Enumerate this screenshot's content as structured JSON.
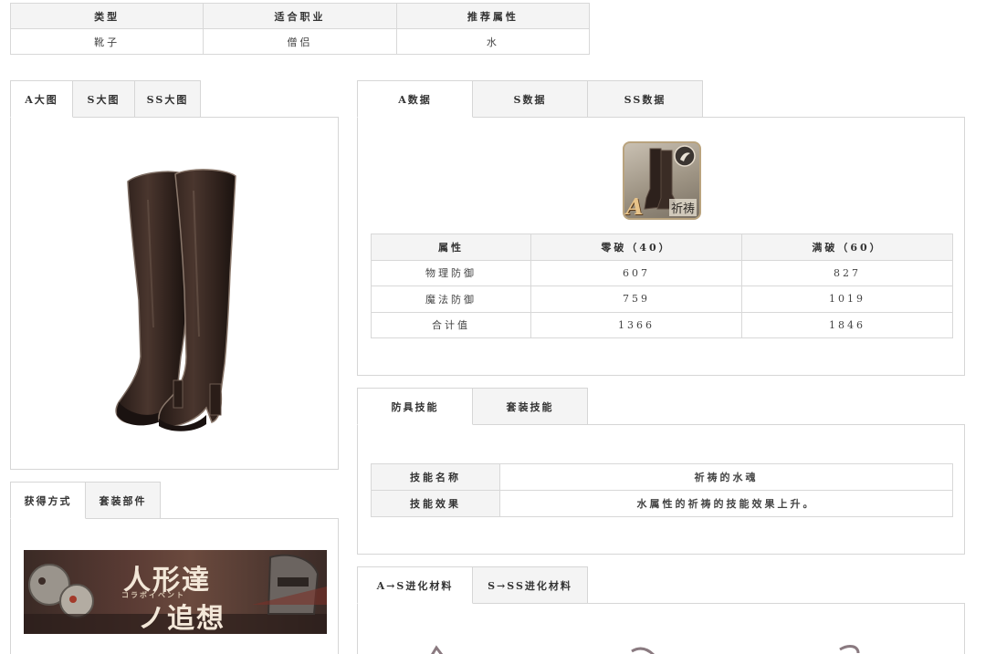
{
  "info": {
    "headers": [
      "类型",
      "适合职业",
      "推荐属性"
    ],
    "values": [
      "靴子",
      "僧侣",
      "水"
    ]
  },
  "image_tabs": [
    "A大图",
    "S大图",
    "SS大图"
  ],
  "data_tabs": [
    "A数据",
    "S数据",
    "SS数据"
  ],
  "item_icon": {
    "name": "boots-item-icon",
    "rank": "A",
    "label": "祈祷"
  },
  "stats": {
    "headers": [
      "属性",
      "零破（40）",
      "满破（60）"
    ],
    "rows": [
      [
        "物理防御",
        "607",
        "827"
      ],
      [
        "魔法防御",
        "759",
        "1019"
      ],
      [
        "合计值",
        "1366",
        "1846"
      ]
    ]
  },
  "skill_tabs": [
    "防具技能",
    "套装技能"
  ],
  "skills": {
    "name_label": "技能名称",
    "name_value": "祈祷的水魂",
    "effect_label": "技能效果",
    "effect_value": "水属性的祈祷的技能效果上升。"
  },
  "evo_tabs": [
    "A→S进化材料",
    "S→SS进化材料"
  ],
  "obtain_tabs": [
    "获得方式",
    "套装部件"
  ],
  "banner": {
    "title_line1": "人形達",
    "subtitle": "コラボイベント",
    "title_line2": "ノ追想"
  },
  "colors": {
    "border": "#d6d6d6",
    "header_bg": "#f4f4f4",
    "boot_leather": "#3b2a24"
  }
}
